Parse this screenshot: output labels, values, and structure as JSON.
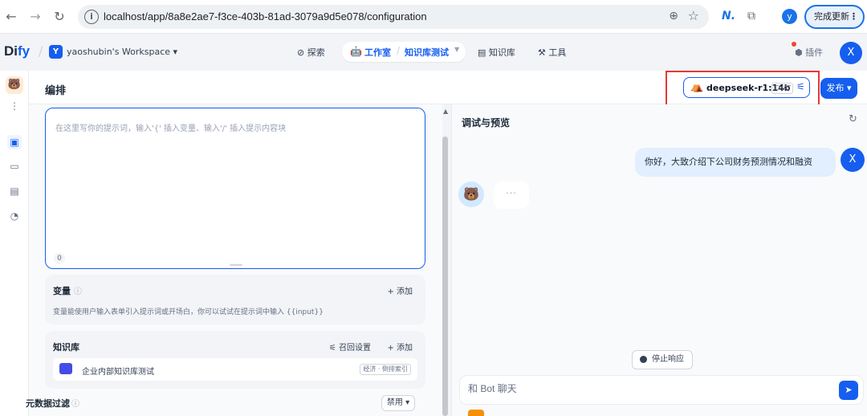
{
  "browser": {
    "url": "localhost/app/8a8e2ae7-f3ce-403b-81ad-3079a9d5e078/configuration",
    "profile_initial": "y",
    "update_label": "完成更新",
    "ext_label": "N."
  },
  "header": {
    "logo_prefix": "Di",
    "logo_accent": "fy",
    "workspace_initial": "Y",
    "workspace_name": "yaoshubin's Workspace",
    "nav": {
      "explore": "探索",
      "studio": "工作室",
      "app_name": "知识库测试",
      "knowledge": "知识库",
      "tools": "工具"
    },
    "plugin_label": "插件",
    "user_initial": "X"
  },
  "orchestrate": {
    "title": "编排",
    "model_name": "deepseek-r1:14b",
    "model_tag": "CHAT",
    "publish_label": "发布"
  },
  "prompt": {
    "placeholder": "在这里写你的提示词，输入'{' 插入变量、输入'/' 插入提示内容块",
    "count": "0"
  },
  "variables": {
    "title": "变量",
    "add_label": "+ 添加",
    "description": "变量能使用户输入表单引入提示词或开场白，你可以试试在提示词中输入 {{input}}"
  },
  "knowledge": {
    "title": "知识库",
    "recall_label": "召回设置",
    "add_label": "+ 添加",
    "item_name": "企业内部知识库测试",
    "item_badge": "经济 · 倒排索引"
  },
  "metadata": {
    "title": "元数据过滤",
    "disable_label": "禁用"
  },
  "debug": {
    "title": "调试与预览",
    "user_message": "你好，大致介绍下公司财务预测情况和融资",
    "user_initial": "X",
    "bot_typing": "···",
    "stop_label": "停止响应",
    "input_placeholder": "和 Bot 聊天"
  },
  "colors": {
    "primary": "#155eef",
    "highlight_box": "#e53935"
  }
}
